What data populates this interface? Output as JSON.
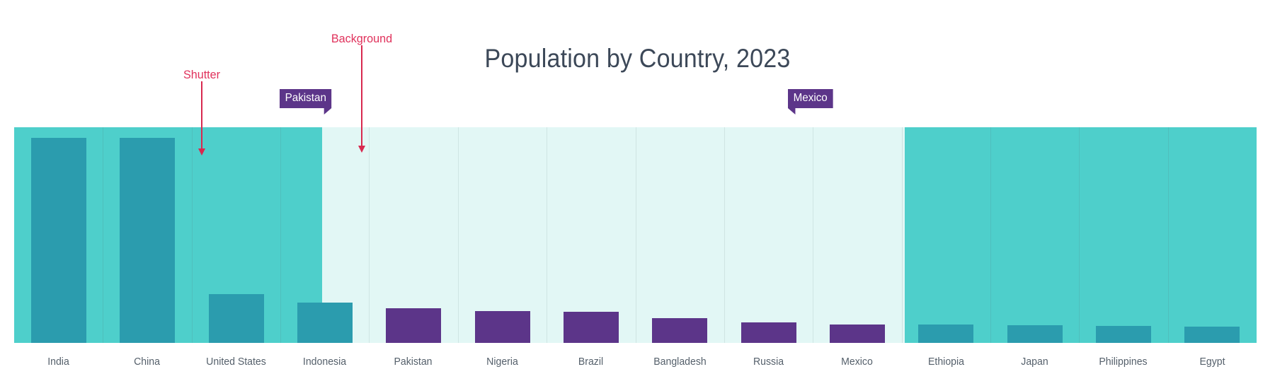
{
  "chart_data": {
    "type": "bar",
    "title": "Population by Country, 2023",
    "xlabel": "",
    "ylabel": "",
    "grid": false,
    "legend": "none",
    "categories": [
      "India",
      "China",
      "United States",
      "Indonesia",
      "Pakistan",
      "Nigeria",
      "Brazil",
      "Bangladesh",
      "Russia",
      "Mexico",
      "Ethiopia",
      "Japan",
      "Philippines",
      "Egypt"
    ],
    "values": [
      1428,
      1425,
      340,
      278,
      240,
      223,
      216,
      173,
      144,
      128,
      127,
      124,
      117,
      113
    ],
    "ylim": [
      0,
      1500
    ],
    "bars": [
      {
        "label": "India",
        "value": 1428,
        "color": "#2b9cae",
        "region": "shutter-left"
      },
      {
        "label": "China",
        "value": 1425,
        "color": "#2b9cae",
        "region": "shutter-left"
      },
      {
        "label": "United States",
        "value": 340,
        "color": "#2b9cae",
        "region": "shutter-left"
      },
      {
        "label": "Indonesia",
        "value": 278,
        "color": "#2b9cae",
        "region": "shutter-left"
      },
      {
        "label": "Pakistan",
        "value": 240,
        "color": "#5c3589",
        "region": "background"
      },
      {
        "label": "Nigeria",
        "value": 223,
        "color": "#5c3589",
        "region": "background"
      },
      {
        "label": "Brazil",
        "value": 216,
        "color": "#5c3589",
        "region": "background"
      },
      {
        "label": "Bangladesh",
        "value": 173,
        "color": "#5c3589",
        "region": "background"
      },
      {
        "label": "Russia",
        "value": 144,
        "color": "#5c3589",
        "region": "background"
      },
      {
        "label": "Mexico",
        "value": 128,
        "color": "#5c3589",
        "region": "background"
      },
      {
        "label": "Ethiopia",
        "value": 127,
        "color": "#2b9cae",
        "region": "shutter-right"
      },
      {
        "label": "Japan",
        "value": 124,
        "color": "#2b9cae",
        "region": "shutter-right"
      },
      {
        "label": "Philippines",
        "value": 117,
        "color": "#2b9cae",
        "region": "shutter-right"
      },
      {
        "label": "Egypt",
        "value": 113,
        "color": "#2b9cae",
        "region": "shutter-right"
      }
    ]
  },
  "title": "Population by Country, 2023",
  "tooltips": [
    {
      "label": "Pakistan",
      "tail": "right"
    },
    {
      "label": "Mexico",
      "tail": "left"
    }
  ],
  "annotations": [
    {
      "label": "Shutter"
    },
    {
      "label": "Background"
    }
  ],
  "colors": {
    "shutter_background": "#4ecfcb",
    "plain_background": "#e2f7f5",
    "shutter_bar": "#2b9cae",
    "plain_bar": "#5c3589",
    "tooltip": "#5c3589",
    "annotation": "#d8294f",
    "title_text": "#3c4858",
    "axis_label_text": "#55606b"
  }
}
